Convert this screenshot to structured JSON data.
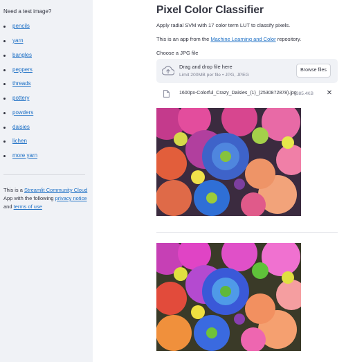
{
  "sidebar": {
    "heading": "Need a test image?",
    "links": [
      "pencils",
      "yarn",
      "bangles",
      "peppers",
      "threads",
      "pottery",
      "powders",
      "daisies",
      "lichen",
      "more yarn"
    ],
    "note": {
      "part1": "This is a ",
      "link1": "Streamlit Community Cloud",
      "part2": " App with the following ",
      "link2": "privacy notice",
      "part3": " and ",
      "link3": "terms of use"
    }
  },
  "main": {
    "title": "Pixel Color Classifier",
    "description": "Apply radial SVM with 17 color term LUT to classify pixels.",
    "repo_text": {
      "part1": "This is an app from the ",
      "link": "Machine Learning and Color",
      "part2": " repository."
    },
    "uploader": {
      "label": "Choose a JPG file",
      "drop_text": "Drag and drop file here",
      "limit_text": "Limit 200MB per file • JPG, JPEG",
      "browse_label": "Browse files",
      "icon": "cloud-upload-icon"
    },
    "uploaded_file": {
      "name": "1600px-Colorful_Crazy_Daisies_(1)_(2530872878).jpg",
      "size": "385.4KB",
      "icon": "file-icon",
      "remove_icon": "close-icon",
      "remove_glyph": "✕"
    }
  },
  "colors": {
    "link": "#1c6fc5",
    "sidebar_bg": "#f0f2f6",
    "text": "#31333f",
    "muted": "#808495"
  }
}
